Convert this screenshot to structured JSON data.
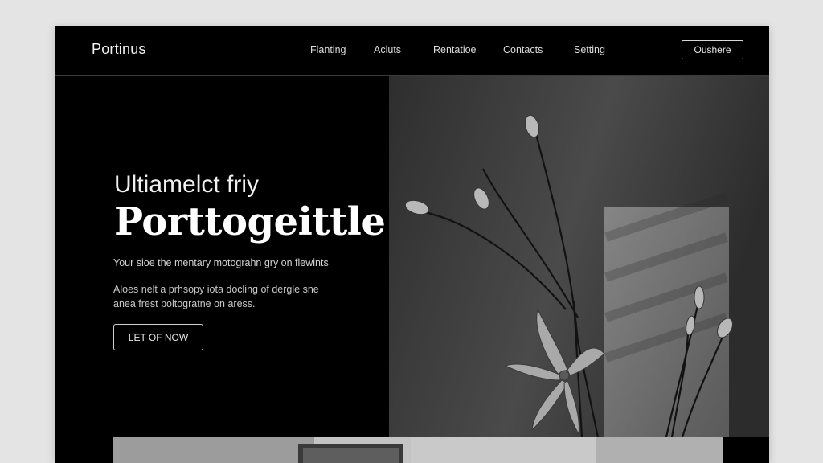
{
  "brand": "Portinus",
  "nav": {
    "links": [
      "Flanting",
      "Acluts",
      "Rentatioe",
      "Contacts",
      "Setting"
    ],
    "cta": "Oushere"
  },
  "hero": {
    "eyebrow": "Ultiamelct friy",
    "title": "Porttogeittle",
    "tagline": "Your sioe the mentary motograhn gry on flewints",
    "description": [
      "Aloes nelt a prhsopy iota docling of dergle sne",
      "anea frest poltogratne on aress."
    ],
    "cta": "LET OF NOW"
  },
  "photo": {
    "subject": "flower-stems-photo"
  },
  "colors": {
    "background": "#000000",
    "page": "#e4e4e4",
    "text": "#ffffff",
    "muted_text": "#c8c8c8",
    "border": "#d8d8d8"
  }
}
